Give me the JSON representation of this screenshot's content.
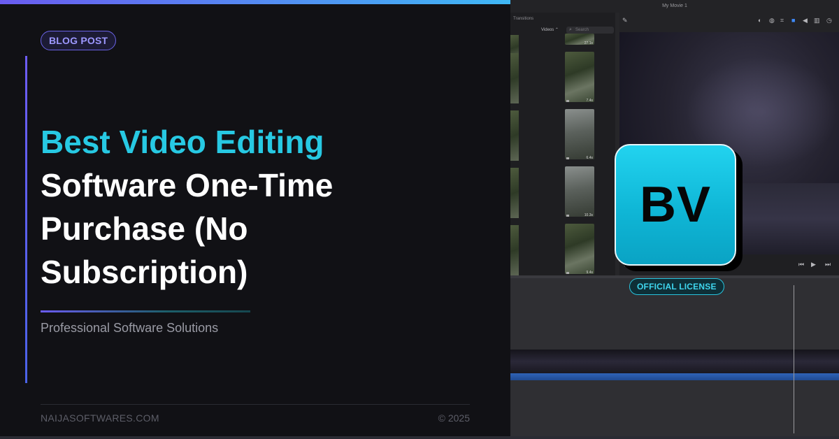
{
  "blog_card": {
    "badge": "BLOG POST",
    "title_highlight": "Best Video Editing",
    "title_rest_line1": "Software One-Time",
    "title_rest_line2": "Purchase (No",
    "title_rest_line3": "Subscription)",
    "subtitle": "Professional Software Solutions",
    "site": "NAIJASOFTWARES.COM",
    "copyright": "© 2025",
    "logo_text": "BV",
    "license_badge": "OFFICIAL LICENSE"
  },
  "editor": {
    "window_title": "My Movie 1",
    "browser_label": "Transitions",
    "media_filter": "Videos ⌃",
    "search_placeholder": "Search",
    "clip_durations": [
      "27.1s",
      "7.4s",
      "6.4s",
      "10.3s",
      "9.4s"
    ],
    "left_durations": [
      ".2s",
      "1.1s",
      ".3s",
      "2.0s",
      "3s"
    ]
  },
  "colors": {
    "accent_cyan": "#27c9e3",
    "accent_purple": "#6a5cf0",
    "background": "#111114"
  },
  "icons": [
    "magic-wand-icon",
    "color-balance-icon",
    "color-correction-icon",
    "crop-icon",
    "stabilization-icon",
    "volume-icon",
    "noise-reduction-icon",
    "speed-icon",
    "microphone-icon",
    "skip-back-icon",
    "play-icon",
    "skip-forward-icon"
  ]
}
